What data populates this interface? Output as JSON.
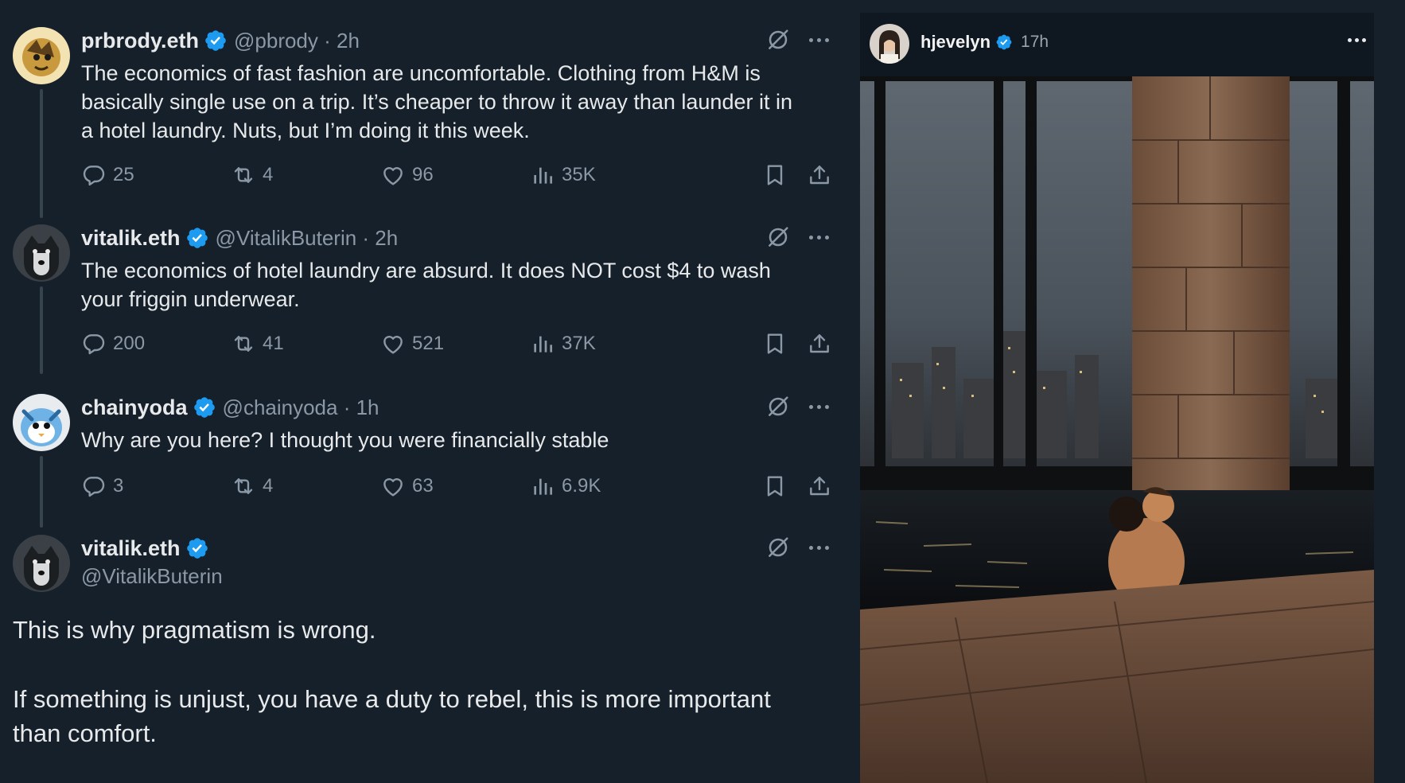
{
  "tweets": [
    {
      "name": "prbrody.eth",
      "meta": "@pbrody · 2h",
      "text_lines": [
        "The economics of fast fashion are uncomfortable.  Clothing from H&M is",
        "basically single use on a trip.  It’s cheaper to throw it away than launder it in",
        "a hotel laundry.  Nuts, but I’m doing it this week."
      ],
      "replies": "25",
      "reposts": "4",
      "likes": "96",
      "views": "35K"
    },
    {
      "name": "vitalik.eth",
      "meta": "@VitalikButerin · 2h",
      "text_lines": [
        "The economics of hotel laundry are absurd. It does NOT cost $4 to wash",
        "your friggin underwear."
      ],
      "replies": "200",
      "reposts": "41",
      "likes": "521",
      "views": "37K"
    },
    {
      "name": "chainyoda",
      "meta": "@chainyoda · 1h",
      "text_lines": [
        "Why are you here? I thought you were financially stable"
      ],
      "replies": "3",
      "reposts": "4",
      "likes": "63",
      "views": "6.9K"
    }
  ],
  "main_tweet": {
    "name": "vitalik.eth",
    "handle": "@VitalikButerin",
    "paragraph1": "This is why pragmatism is wrong.",
    "paragraph2_lines": [
      "If something is unjust, you have a duty to rebel, this is more important",
      "than comfort."
    ]
  },
  "story": {
    "username": "hjevelyn",
    "time": "17h"
  },
  "colors": {
    "background": "#15202b",
    "verified": "#1d9bf0",
    "muted": "#8b98a5"
  }
}
